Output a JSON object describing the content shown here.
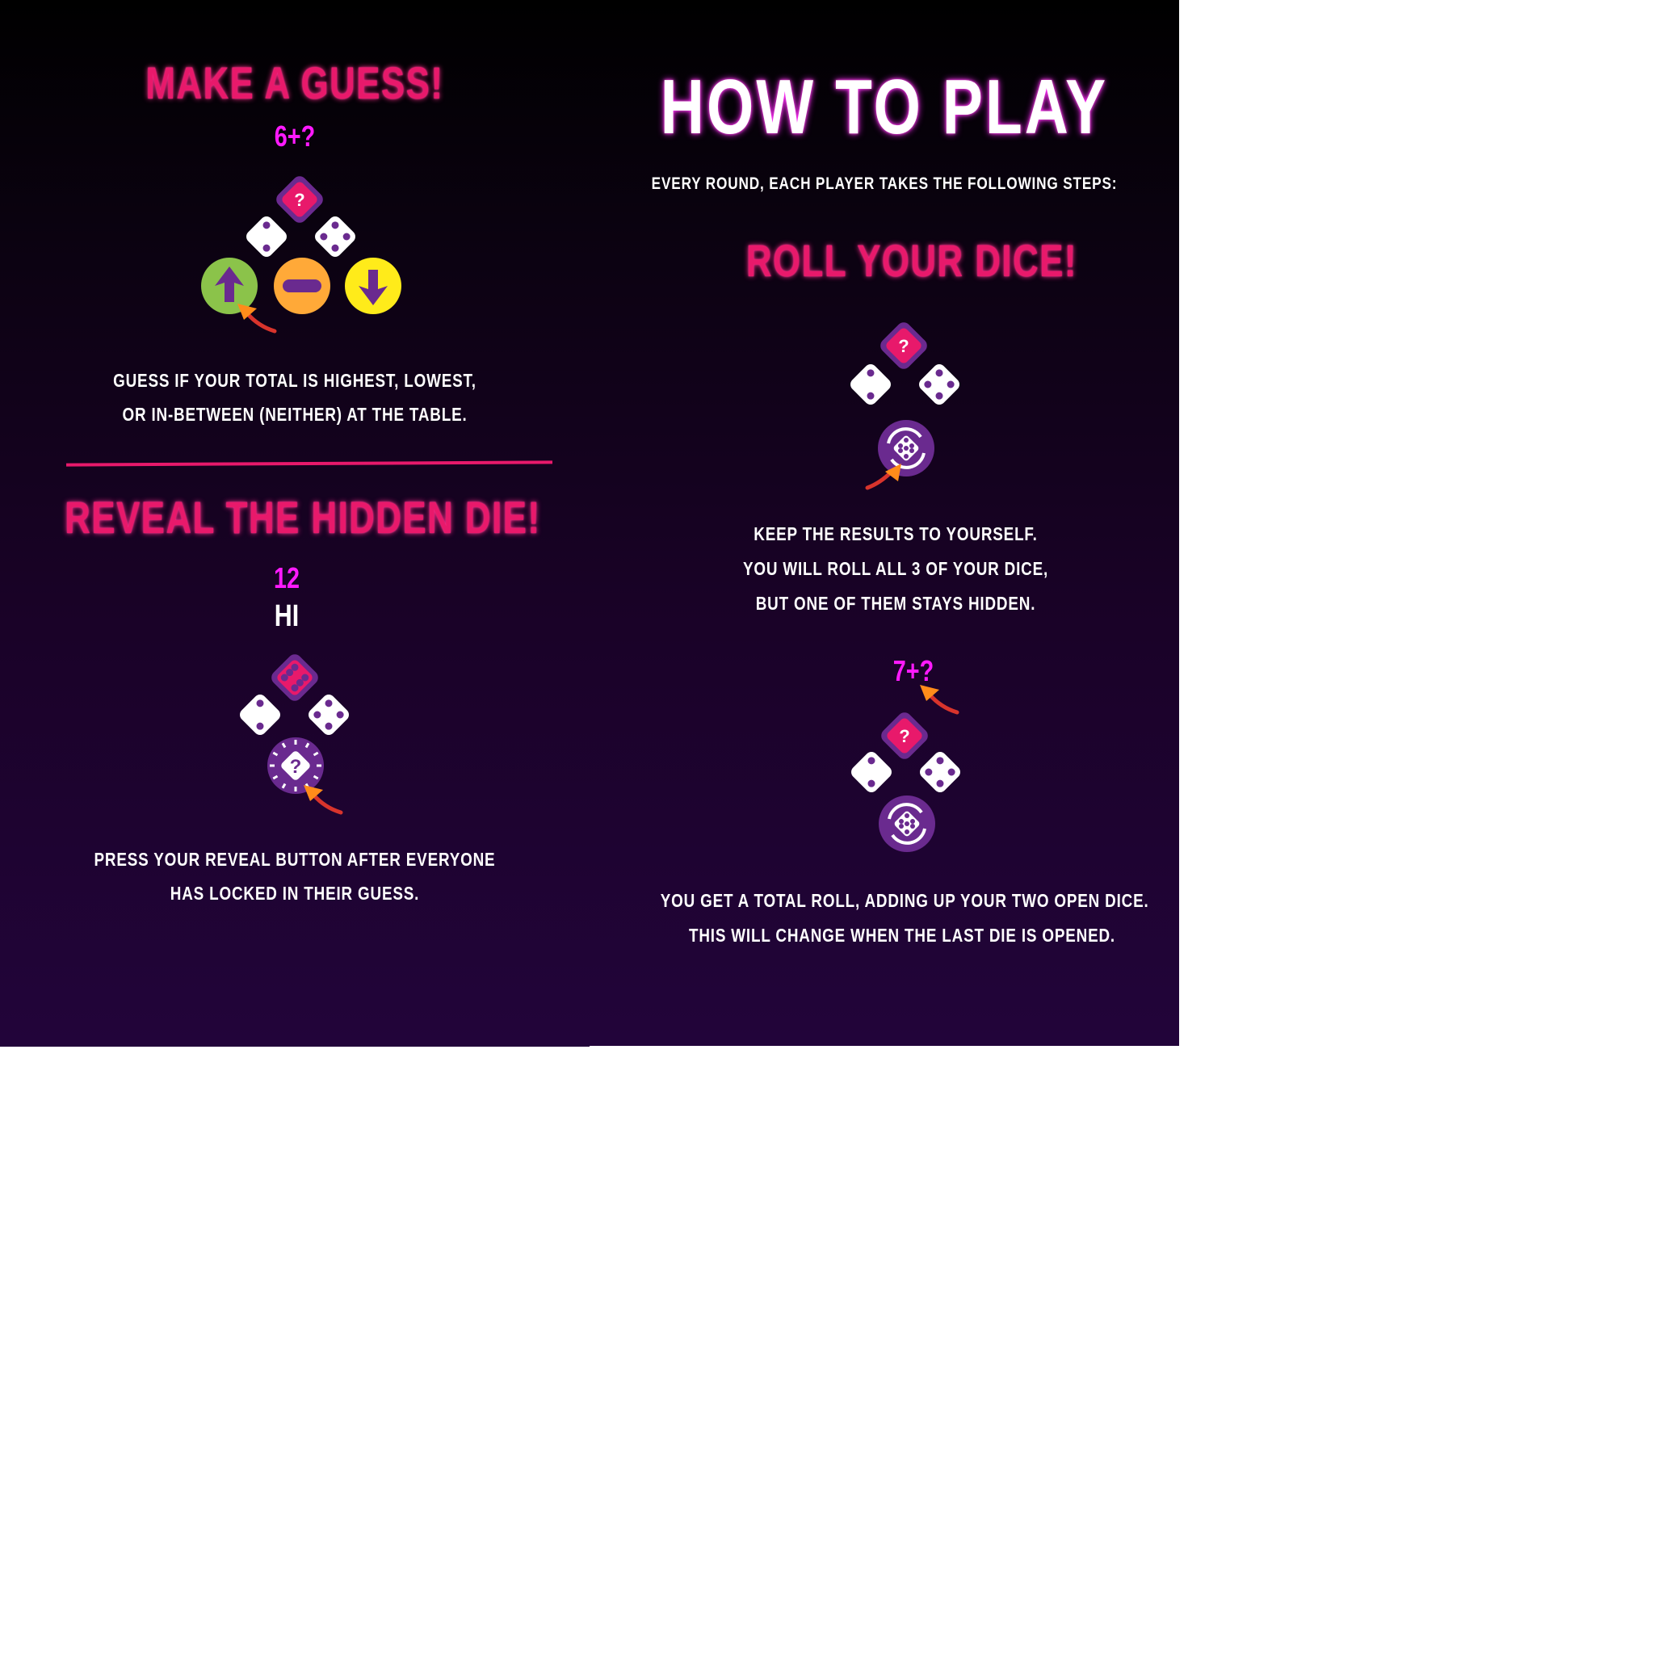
{
  "left": {
    "guess_title": "MAKE A GUESS!",
    "guess_total": "6+?",
    "guess_text": [
      "GUESS IF YOUR TOTAL IS HIGHEST,  LOWEST,",
      "OR IN-BETWEEN (NEITHER) AT THE TABLE."
    ],
    "reveal_title": "REVEAL THE HIDDEN DIE!",
    "reveal_total": "12",
    "reveal_result": "HI",
    "reveal_text": [
      "PRESS YOUR REVEAL BUTTON AFTER EVERYONE",
      "HAS LOCKED IN THEIR GUESS."
    ]
  },
  "right": {
    "title": "HOW TO PLAY",
    "subtitle": "EVERY ROUND,  EACH PLAYER TAKES THE FOLLOWING STEPS:",
    "roll_title": "ROLL YOUR DICE!",
    "roll_text": [
      "KEEP THE RESULTS TO YOURSELF.",
      "YOU WILL ROLL ALL 3 OF YOUR DICE,",
      "BUT ONE OF THEM STAYS HIDDEN."
    ],
    "total_label": "7+?",
    "total_text": [
      "YOU GET A TOTAL ROLL,  ADDING UP YOUR TWO OPEN DICE.",
      "THIS WILL CHANGE WHEN THE LAST DIE IS OPENED."
    ]
  },
  "colors": {
    "pink": "#e8196b",
    "purple": "#6a2a8f",
    "magenta": "#ff1aff",
    "green": "#8bc34a",
    "orange": "#ffa938",
    "yellow": "#ffeb1a"
  }
}
